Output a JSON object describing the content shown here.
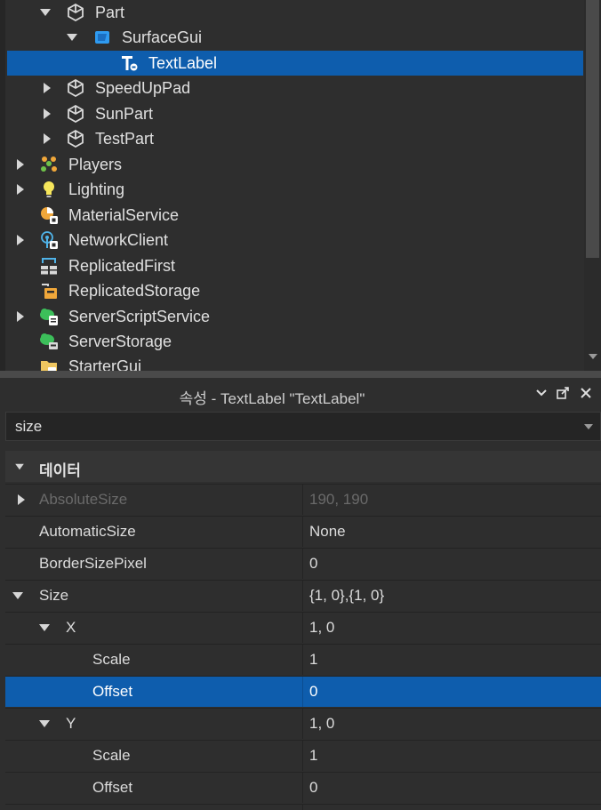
{
  "explorer": {
    "items": [
      {
        "label": "Part",
        "expanded": true,
        "icon": "part-cube-icon"
      },
      {
        "label": "SurfaceGui",
        "expanded": true,
        "icon": "surfacegui-icon"
      },
      {
        "label": "TextLabel",
        "selected": true,
        "icon": "textlabel-icon"
      },
      {
        "label": "SpeedUpPad",
        "expanded": false,
        "icon": "part-cube-icon"
      },
      {
        "label": "SunPart",
        "expanded": false,
        "icon": "part-cube-icon"
      },
      {
        "label": "TestPart",
        "expanded": false,
        "icon": "part-cube-icon"
      },
      {
        "label": "Players",
        "expanded": false,
        "icon": "players-icon"
      },
      {
        "label": "Lighting",
        "expanded": false,
        "icon": "lighting-bulb-icon"
      },
      {
        "label": "MaterialService",
        "icon": "material-service-icon"
      },
      {
        "label": "NetworkClient",
        "expanded": false,
        "icon": "network-client-icon"
      },
      {
        "label": "ReplicatedFirst",
        "icon": "replicated-first-icon"
      },
      {
        "label": "ReplicatedStorage",
        "icon": "replicated-storage-icon"
      },
      {
        "label": "ServerScriptService",
        "expanded": false,
        "icon": "server-script-service-icon"
      },
      {
        "label": "ServerStorage",
        "icon": "server-storage-icon"
      },
      {
        "label": "StarterGui",
        "icon": "starter-gui-icon"
      }
    ]
  },
  "properties": {
    "title": "속성 - TextLabel \"TextLabel\"",
    "filter_value": "size",
    "section_label": "데이터",
    "rows": [
      {
        "name": "AbsoluteSize",
        "value": "190, 190"
      },
      {
        "name": "AutomaticSize",
        "value": "None"
      },
      {
        "name": "BorderSizePixel",
        "value": "0"
      },
      {
        "name": "Size",
        "value": "{1, 0},{1, 0}"
      },
      {
        "name": "X",
        "value": "1, 0"
      },
      {
        "name": "Scale",
        "value": "1"
      },
      {
        "name": "Offset",
        "value": "0"
      },
      {
        "name": "Y",
        "value": "1, 0"
      },
      {
        "name": "Scale",
        "value": "1"
      },
      {
        "name": "Offset",
        "value": "0"
      }
    ]
  },
  "colors": {
    "selection": "#0e5dad",
    "panel_bg": "#2e2e2e",
    "text": "#d6d6d6",
    "dim_text": "#6a6a6a"
  }
}
